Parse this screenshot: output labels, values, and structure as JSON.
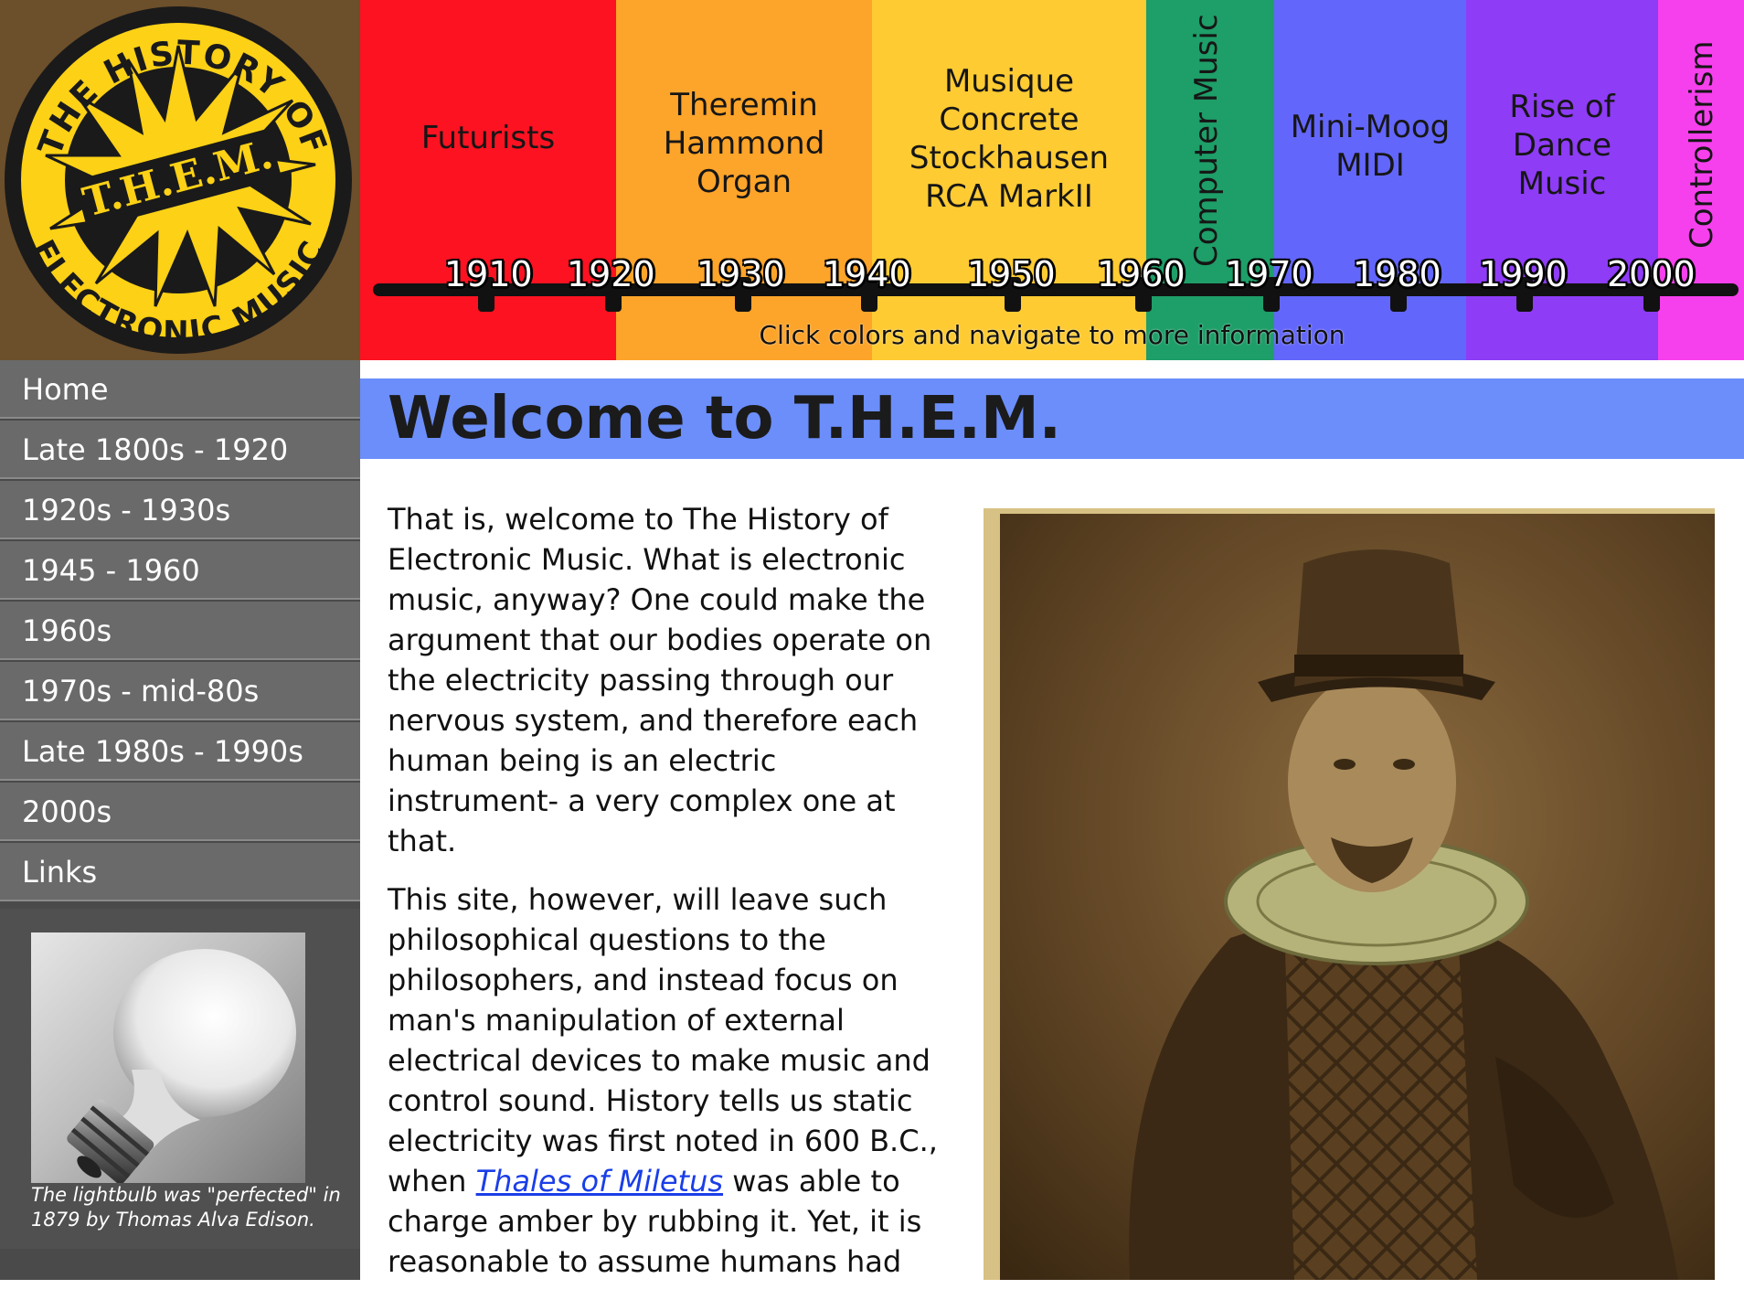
{
  "logo": {
    "top_text": "THE HISTORY OF",
    "bottom_text": "ELECTRONIC MUSIC",
    "center_text": "T.H.E.M."
  },
  "timeline": {
    "bands": [
      {
        "label_lines": [
          "Futurists"
        ],
        "color": "#fc1221"
      },
      {
        "label_lines": [
          "Theremin",
          "Hammond",
          "Organ"
        ],
        "color": "#fda42a"
      },
      {
        "label_lines": [
          "Musique",
          "Concrete",
          "Stockhausen",
          "RCA MarkII"
        ],
        "color": "#fecb33"
      },
      {
        "label_lines": [
          "Computer Music"
        ],
        "color": "#1e9e68",
        "vertical": true
      },
      {
        "label_lines": [
          "Mini-Moog",
          "MIDI"
        ],
        "color": "#6366fb"
      },
      {
        "label_lines": [
          "Rise of",
          "Dance",
          "Music"
        ],
        "color": "#8e3cf6"
      },
      {
        "label_lines": [
          "Controllerism"
        ],
        "color": "#f640ed",
        "vertical": true
      }
    ],
    "years": [
      "1910",
      "1920",
      "1930",
      "1940",
      "1950",
      "1960",
      "1970",
      "1980",
      "1990",
      "2000"
    ],
    "hint": "Click colors and navigate to more information"
  },
  "nav": {
    "items": [
      "Home",
      "Late 1800s - 1920",
      "1920s - 1930s",
      "1945 - 1960",
      "1960s",
      "1970s - mid-80s",
      "Late 1980s - 1990s",
      "2000s",
      "Links"
    ]
  },
  "sidebar_image": {
    "subject": "lightbulb-photo",
    "caption": "The lightbulb was \"perfected\" in 1879 by Thomas Alva Edison."
  },
  "main": {
    "title": "Welcome to T.H.E.M.",
    "paragraph1": "That is, welcome to The History of Electronic Music. What is electronic music, anyway? One could make the argument that our bodies operate on the electricity passing through our nervous system, and therefore each human being is an electric instrument- a very complex one at that.",
    "paragraph2_before_link": "This site, however, will leave such philosophical questions to the philosophers, and instead focus on man's manipulation of external electrical devices to make music and control sound. History tells us static electricity was first noted in 600 B.C., when ",
    "paragraph2_link": "Thales of Miletus",
    "paragraph2_after_link": " was able to charge amber by rubbing it. Yet, it is reasonable to assume humans had",
    "portrait_subject": "engraved-portrait"
  }
}
